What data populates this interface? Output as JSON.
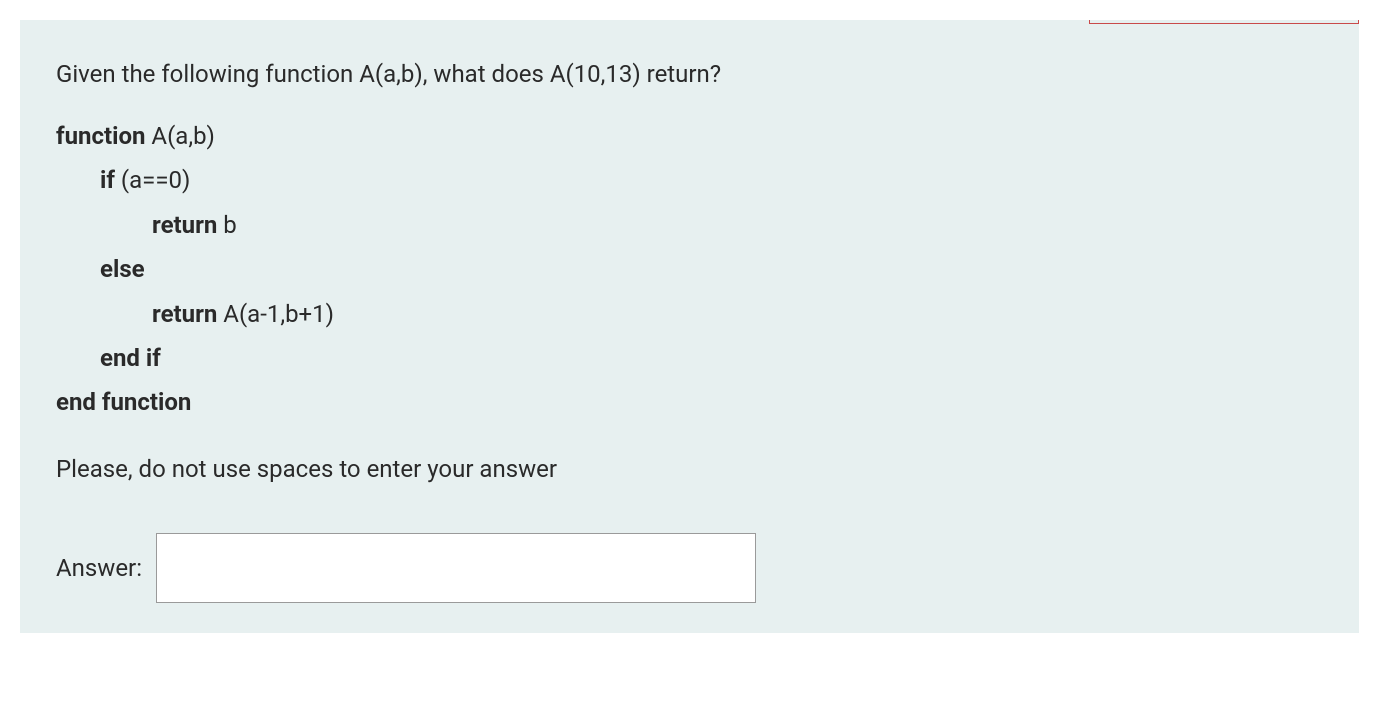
{
  "question": {
    "prompt": "Given the following function A(a,b), what does A(10,13) return?",
    "code": {
      "line1_kw": "function",
      "line1_rest": " A(a,b)",
      "line2_kw": "if",
      "line2_rest": " (a==0)",
      "line3_kw": "return",
      "line3_rest": " b",
      "line4_kw": "else",
      "line5_kw": "return",
      "line5_rest": " A(a-1,b+1)",
      "line6_kw": "end if",
      "line7_kw": "end function"
    },
    "instruction": "Please, do not use spaces to enter your answer",
    "answer_label": "Answer:",
    "answer_value": ""
  }
}
